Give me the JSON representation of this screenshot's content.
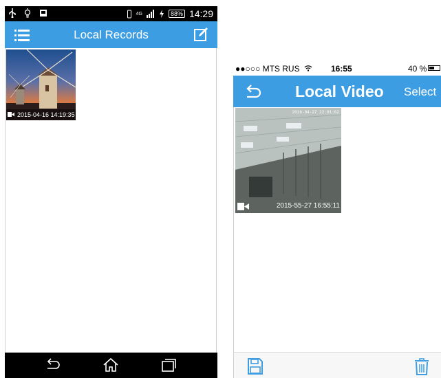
{
  "android": {
    "status": {
      "icons_left": [
        "usb-icon",
        "bulb-icon",
        "sd-card-icon"
      ],
      "network": "4G",
      "battery": "88%",
      "time": "14:29"
    },
    "header": {
      "title": "Local Records"
    },
    "records": [
      {
        "timestamp": "2015-04-16 14:19:35"
      }
    ],
    "nav": [
      "back-icon",
      "home-icon",
      "recent-apps-icon"
    ]
  },
  "ios": {
    "status": {
      "carrier": "●●○○○ MTS RUS",
      "time": "16:55",
      "battery": "40 %"
    },
    "header": {
      "title": "Local Video",
      "select_label": "Select"
    },
    "videos": [
      {
        "overlay_timestamp": "2016-04-27 22:01:02",
        "timestamp": "2015-55-27 16:55:11"
      }
    ],
    "toolbar": [
      "save-icon",
      "trash-icon"
    ]
  },
  "colors": {
    "header_blue": "#3d9de3",
    "android_bars": "#000000",
    "ios_toolbar": "#f7f7f7"
  }
}
